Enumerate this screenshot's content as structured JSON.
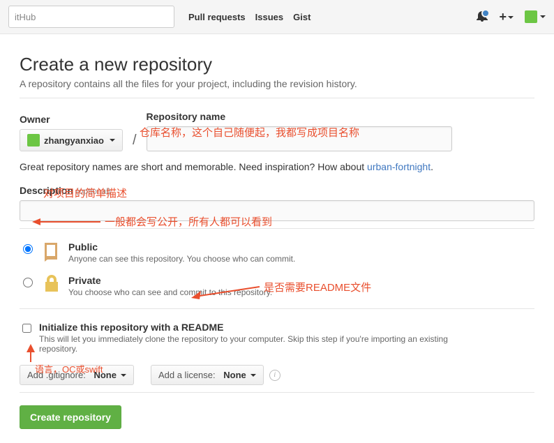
{
  "topbar": {
    "search_placeholder": "itHub",
    "links": [
      "Pull requests",
      "Issues",
      "Gist"
    ]
  },
  "page": {
    "title": "Create a new repository",
    "subtitle": "A repository contains all the files for your project, including the revision history."
  },
  "owner": {
    "label": "Owner",
    "username": "zhangyanxiao"
  },
  "repo": {
    "label": "Repository name"
  },
  "hint": {
    "prefix": "Great repository names are short and memorable. Need inspiration? How about ",
    "suggestion": "urban-fortnight",
    "suffix": "."
  },
  "description": {
    "label": "Description",
    "optional": "(optional)"
  },
  "visibility": {
    "public": {
      "title": "Public",
      "sub": "Anyone can see this repository. You choose who can commit."
    },
    "private": {
      "title": "Private",
      "sub": "You choose who can see and commit to this repository."
    }
  },
  "readme": {
    "title": "Initialize this repository with a README",
    "sub": "This will let you immediately clone the repository to your computer. Skip this step if you're importing an existing repository."
  },
  "dropdowns": {
    "gitignore_label": "Add .gitignore:",
    "gitignore_value": "None",
    "license_label": "Add a license:",
    "license_value": "None"
  },
  "submit": "Create repository",
  "annotations": {
    "repo_name": "仓库名称，这个自己随便起，我都写成项目名称",
    "desc": "对项目的简单描述",
    "public": "一般都会写公开，所有人都可以看到",
    "readme": "是否需要README文件",
    "lang": "语言，OC或swift"
  }
}
